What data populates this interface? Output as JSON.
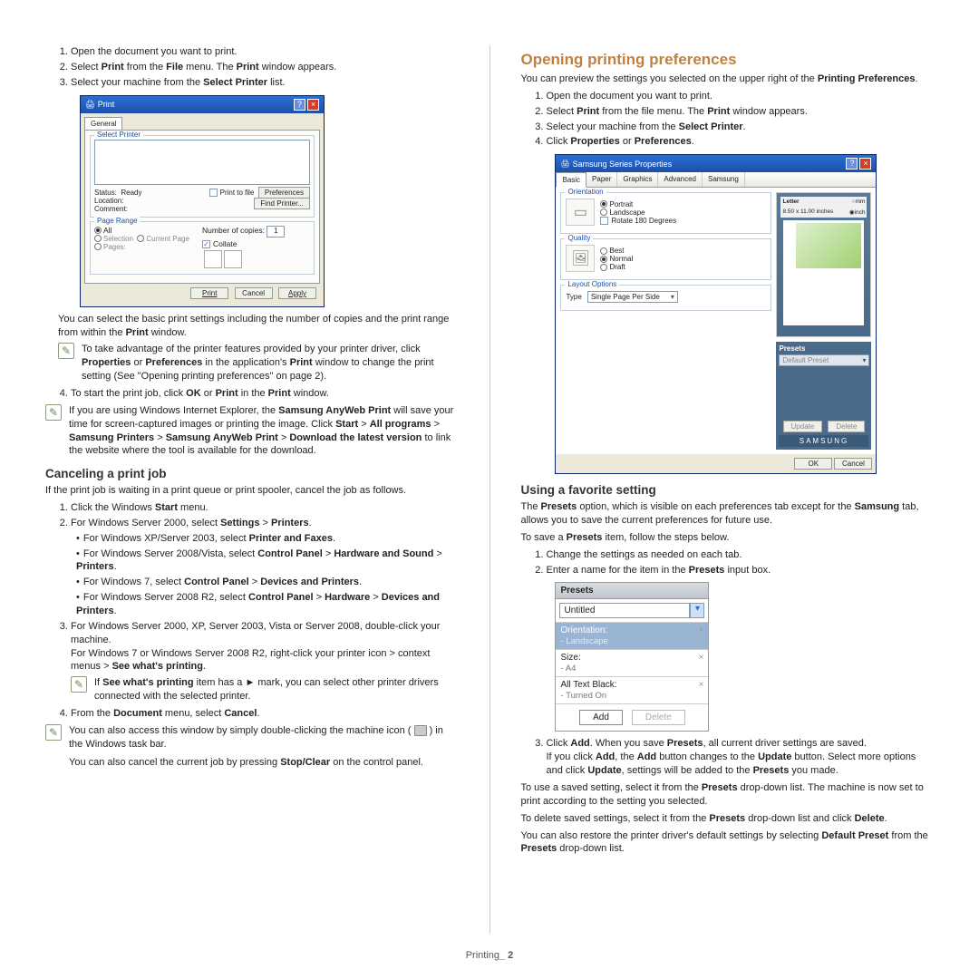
{
  "left": {
    "steps1": {
      "s1": "Open the document you want to print.",
      "s2a": "Select ",
      "s2b": "Print",
      "s2c": " from the ",
      "s2d": "File",
      "s2e": " menu. The ",
      "s2f": "Print",
      "s2g": " window appears.",
      "s3a": "Select your machine from the ",
      "s3b": "Select Printer",
      "s3c": " list."
    },
    "print_dlg": {
      "title": "Print",
      "tab": "General",
      "g1": "Select Printer",
      "status_l": "Status:",
      "status_v": "Ready",
      "loc_l": "Location:",
      "com_l": "Comment:",
      "ptf": "Print to file",
      "pref": "Preferences",
      "find": "Find Printer...",
      "g2": "Page Range",
      "all": "All",
      "selc": "Selection",
      "curp": "Current Page",
      "pages": "Pages:",
      "copies": "Number of copies:",
      "copies_v": "1",
      "collate": "Collate",
      "b_print": "Print",
      "b_cancel": "Cancel",
      "b_apply": "Apply"
    },
    "after1a": "You can select the basic print settings including the number of copies and the print range from within the ",
    "after1b": "Print",
    "after1c": " window.",
    "note1a": "To take advantage of the printer features provided by your printer driver, click ",
    "note1b": "Properties",
    "note1c": " or ",
    "note1d": "Preferences",
    "note1e": " in the application's ",
    "note1f": "Print",
    "note1g": " window to change the print setting (See \"Opening printing preferences\" on page 2).",
    "s4a": "To start the print job, click ",
    "s4b": "OK",
    "s4c": " or ",
    "s4d": "Print",
    "s4e": " in the ",
    "s4f": "Print",
    "s4g": " window.",
    "note2a": "If you are using Windows Internet Explorer, the ",
    "note2b": "Samsung AnyWeb Print",
    "note2c": " will save your time for screen-captured images or printing the image. Click ",
    "note2d": "Start",
    "note2e": " > ",
    "note2f": "All programs",
    "note2g": " > ",
    "note2h": "Samsung Printers",
    "note2i": " > ",
    "note2j": "Samsung AnyWeb Print",
    "note2k": " > ",
    "note2l": "Download the latest version",
    "note2m": " to link the website where the tool is available for the download.",
    "h_cancel": "Canceling a print job",
    "cancel_intro": "If the print job is waiting in a print queue or print spooler, cancel the job as follows.",
    "c1a": "Click the Windows ",
    "c1b": "Start",
    "c1c": " menu.",
    "c2a": "For Windows Server 2000, select ",
    "c2b": "Settings",
    "c2c": " > ",
    "c2d": "Printers",
    "c2e": ".",
    "c2_xp_a": "For Windows XP/Server 2003, select ",
    "c2_xp_b": "Printer and Faxes",
    "c2_xp_c": ".",
    "c2_v1a": "For Windows Server 2008/Vista, select ",
    "c2_v1b": "Control Panel",
    "c2_v1c": " > ",
    "c2_v1d": "Hardware and Sound",
    "c2_v1e": " > ",
    "c2_v1f": "Printers",
    "c2_v1g": ".",
    "c2_w7a": "For Windows 7, select ",
    "c2_w7b": "Control Panel",
    "c2_w7c": " > ",
    "c2_w7d": "Devices and Printers",
    "c2_w7e": ".",
    "c2_r2a": "For Windows Server 2008 R2, select ",
    "c2_r2b": "Control Panel",
    "c2_r2c": " > ",
    "c2_r2d": "Hardware",
    "c2_r2e": " > ",
    "c2_r2f": "Devices and Printers",
    "c2_r2g": ".",
    "c3a": "For Windows Server 2000, XP, Server 2003, Vista or Server 2008, double-click your machine.",
    "c3b": "For Windows 7 or Windows Server 2008 R2, right-click your printer icon > context menus > ",
    "c3c": "See what's printing",
    "c3d": ".",
    "note3a": "If ",
    "note3b": "See what's printing",
    "note3c": " item has a ► mark, you can select other printer drivers connected with the selected printer.",
    "c4a": "From the ",
    "c4b": "Document",
    "c4c": " menu, select ",
    "c4d": "Cancel",
    "c4e": ".",
    "note4a": "You can also access this window by simply double-clicking the machine icon ( ",
    "note4b": " ) in the Windows task bar.",
    "note4c": "You can also cancel the current job by pressing ",
    "note4d": "Stop/Clear",
    "note4e": " on the control panel."
  },
  "right": {
    "h_open": "Opening printing preferences",
    "intro_a": "You can preview the settings you selected on the upper right of the ",
    "intro_b": "Printing Preferences",
    "intro_c": ".",
    "r1": "Open the document you want to print.",
    "r2a": "Select ",
    "r2b": "Print",
    "r2c": " from the file menu. The ",
    "r2d": "Print",
    "r2e": " window appears.",
    "r3a": "Select your machine from the ",
    "r3b": "Select Printer",
    "r3c": ".",
    "r4a": "Click ",
    "r4b": "Properties",
    "r4c": " or ",
    "r4d": "Preferences",
    "r4e": ".",
    "pdlg": {
      "title": "Samsung Series Properties",
      "tabs": [
        "Basic",
        "Paper",
        "Graphics",
        "Advanced",
        "Samsung"
      ],
      "orientation": "Orientation",
      "portrait": "Portrait",
      "landscape": "Landscape",
      "rotate": "Rotate 180 Degrees",
      "quality": "Quality",
      "best": "Best",
      "normal": "Normal",
      "draft": "Draft",
      "layout": "Layout Options",
      "type": "Type",
      "type_v": "Single Page Per Side",
      "paper": "Letter",
      "mm": "mm",
      "size": "8.50 x 11.00 inches",
      "inch": "inch",
      "presets": "Presets",
      "def": "Default Preset",
      "update": "Update",
      "delete": "Delete",
      "samsung": "SAMSUNG",
      "ok": "OK",
      "cancel": "Cancel"
    },
    "h_fav": "Using a favorite setting",
    "fav1a": "The ",
    "fav1b": "Presets",
    "fav1c": " option, which is visible on each preferences tab except for the ",
    "fav1d": "Samsung",
    "fav1e": " tab, allows you to save the current preferences for future use.",
    "fav2a": "To save a ",
    "fav2b": "Presets",
    "fav2c": " item, follow the steps below.",
    "f1": "Change the settings as needed on each tab.",
    "f2a": "Enter a name for the item in the ",
    "f2b": "Presets",
    "f2c": " input box.",
    "pre": {
      "title": "Presets",
      "untitled": "Untitled",
      "orient": "Orientation:",
      "orient_v": "- Landscape",
      "size": "Size:",
      "size_v": "- A4",
      "black": "All Text Black:",
      "black_v": "- Turned On",
      "add": "Add",
      "del": "Delete"
    },
    "f3a": "Click ",
    "f3b": "Add",
    "f3c": ". When you save ",
    "f3d": "Presets",
    "f3e": ", all current driver settings are saved.",
    "f4a": "If you click ",
    "f4b": "Add",
    "f4c": ", the ",
    "f4d": "Add",
    "f4e": " button changes to the ",
    "f4f": "Update",
    "f4g": " button. Select more options and click ",
    "f4h": "Update",
    "f4i": ", settings will be added to the ",
    "f4j": "Presets",
    "f4k": " you made.",
    "f5a": "To use a saved setting, select it from the ",
    "f5b": "Presets",
    "f5c": " drop-down list. The machine is now set to print according to the setting you selected.",
    "f6a": "To delete saved settings, select it from the ",
    "f6b": "Presets",
    "f6c": " drop-down list and click ",
    "f6d": "Delete",
    "f6e": ".",
    "f7a": "You can also restore the printer driver's default settings by selecting ",
    "f7b": "Default Preset",
    "f7c": " from the ",
    "f7d": "Presets",
    "f7e": " drop-down list."
  },
  "footer_a": "Printing",
  "footer_b": "_ 2"
}
